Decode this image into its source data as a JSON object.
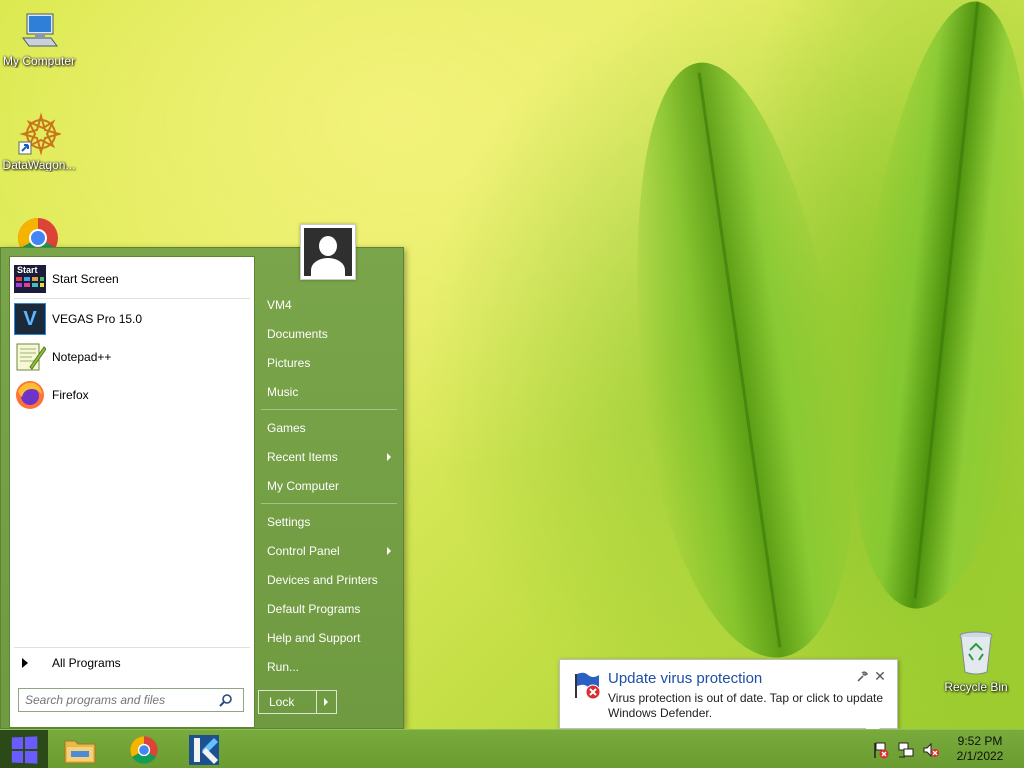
{
  "desktop": {
    "icons": [
      {
        "label": "My Computer",
        "icon": "computer-icon"
      },
      {
        "label": "DataWagon...",
        "icon": "datawagon-icon"
      },
      {
        "label": "Recycle Bin",
        "icon": "recycle-bin-icon"
      }
    ]
  },
  "start_menu": {
    "pinned": [
      {
        "label": "Start Screen",
        "icon": "start-screen-icon"
      },
      {
        "label": "VEGAS Pro 15.0",
        "icon": "vegas-icon"
      },
      {
        "label": "Notepad++",
        "icon": "notepadpp-icon"
      },
      {
        "label": "Firefox",
        "icon": "firefox-icon"
      }
    ],
    "start_screen_badge": "Start",
    "vegas_badge": "V",
    "all_programs": "All Programs",
    "search_placeholder": "Search programs and files",
    "right_links": [
      {
        "label": "VM4"
      },
      {
        "label": "Documents"
      },
      {
        "label": "Pictures"
      },
      {
        "label": "Music"
      },
      {
        "label": "Games"
      },
      {
        "label": "Recent Items",
        "submenu": true
      },
      {
        "label": "My Computer"
      },
      {
        "label": "Settings"
      },
      {
        "label": "Control Panel",
        "submenu": true
      },
      {
        "label": "Devices and Printers"
      },
      {
        "label": "Default Programs"
      },
      {
        "label": "Help and Support"
      },
      {
        "label": "Run..."
      }
    ],
    "lock_label": "Lock"
  },
  "notification": {
    "title": "Update virus protection",
    "body": "Virus protection is out of date. Tap or click to update Windows Defender.",
    "close": "✕"
  },
  "taskbar": {
    "apps": [
      "file-explorer-icon",
      "chrome-icon",
      "kodi-icon"
    ],
    "clock_time": "9:52 PM",
    "clock_date": "2/1/2022",
    "accent": "#6a9c31"
  }
}
